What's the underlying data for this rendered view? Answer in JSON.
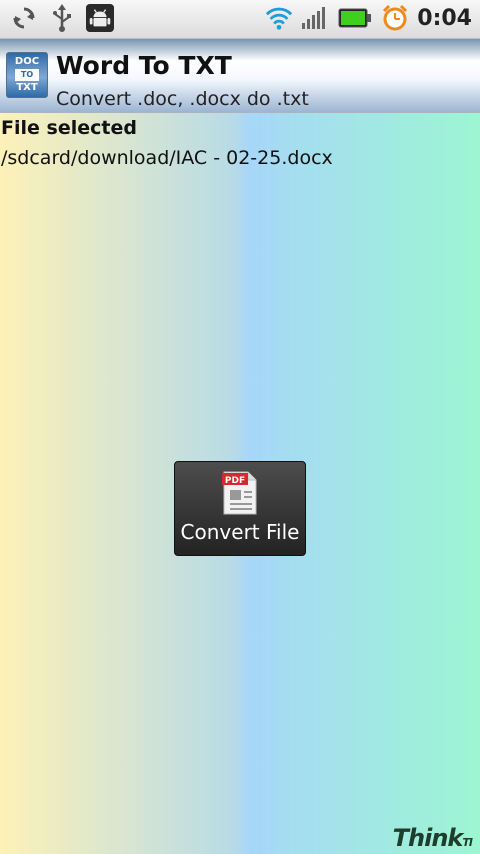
{
  "status_bar": {
    "time": "0:04",
    "icons": [
      "sync-icon",
      "usb-icon",
      "debug-android-icon",
      "wifi-icon",
      "signal-icon",
      "battery-icon",
      "alarm-icon"
    ]
  },
  "app": {
    "title": "Word To TXT",
    "subtitle": "Convert .doc, .docx do .txt",
    "icon_text": [
      "DOC",
      "TO",
      "TXT"
    ]
  },
  "content": {
    "file_label": "File selected",
    "file_path": "/sdcard/download/IAC - 02-25.docx"
  },
  "convert_button": {
    "label": "Convert File",
    "icon_text": "PDF"
  },
  "brand": {
    "text": "Think",
    "suffix": "TI"
  },
  "colors": {
    "accent": "#2e6aa6",
    "pdf_red": "#d12b2b",
    "battery_green": "#3fcf1f",
    "alarm_orange": "#f08a1c"
  }
}
